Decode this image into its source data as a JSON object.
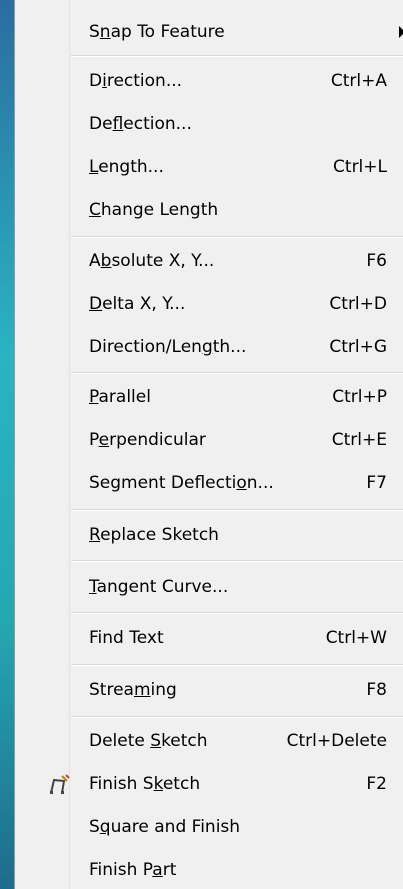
{
  "menu": {
    "items": [
      {
        "label_pre": "S",
        "label_ul": "n",
        "label_post": "ap To Feature",
        "shortcut": "",
        "submenu": true
      },
      {
        "label_pre": "D",
        "label_ul": "i",
        "label_post": "rection...",
        "shortcut": "Ctrl+A"
      },
      {
        "label_pre": "De",
        "label_ul": "f",
        "label_post": "lection...",
        "shortcut": ""
      },
      {
        "label_pre": "",
        "label_ul": "L",
        "label_post": "ength...",
        "shortcut": "Ctrl+L"
      },
      {
        "label_pre": "",
        "label_ul": "C",
        "label_post": "hange Length",
        "shortcut": ""
      },
      {
        "label_pre": "A",
        "label_ul": "b",
        "label_post": "solute X, Y...",
        "shortcut": "F6"
      },
      {
        "label_pre": "",
        "label_ul": "D",
        "label_post": "elta X, Y...",
        "shortcut": "Ctrl+D"
      },
      {
        "label_pre": "Direction/Len",
        "label_ul": "g",
        "label_post": "th...",
        "shortcut": "Ctrl+G"
      },
      {
        "label_pre": "",
        "label_ul": "P",
        "label_post": "arallel",
        "shortcut": "Ctrl+P"
      },
      {
        "label_pre": "P",
        "label_ul": "e",
        "label_post": "rpendicular",
        "shortcut": "Ctrl+E"
      },
      {
        "label_pre": "Segment Deflecti",
        "label_ul": "o",
        "label_post": "n...",
        "shortcut": "F7"
      },
      {
        "label_pre": "",
        "label_ul": "R",
        "label_post": "eplace Sketch",
        "shortcut": ""
      },
      {
        "label_pre": "",
        "label_ul": "T",
        "label_post": "angent Curve...",
        "shortcut": ""
      },
      {
        "label_pre": "Find Text",
        "label_ul": "",
        "label_post": "",
        "shortcut": "Ctrl+W"
      },
      {
        "label_pre": "Strea",
        "label_ul": "m",
        "label_post": "ing",
        "shortcut": "F8"
      },
      {
        "label_pre": "Delete ",
        "label_ul": "S",
        "label_post": "ketch",
        "shortcut": "Ctrl+Delete"
      },
      {
        "label_pre": "Finish S",
        "label_ul": "k",
        "label_post": "etch",
        "shortcut": "F2",
        "icon": "finish-sketch-icon"
      },
      {
        "label_pre": "S",
        "label_ul": "q",
        "label_post": "uare and Finish",
        "shortcut": ""
      },
      {
        "label_pre": "Finish P",
        "label_ul": "a",
        "label_post": "rt",
        "shortcut": ""
      }
    ]
  },
  "colors": {
    "menu_bg": "#f0f0f0",
    "separator": "#d7d7d7",
    "desktop": "#1f86a8"
  }
}
